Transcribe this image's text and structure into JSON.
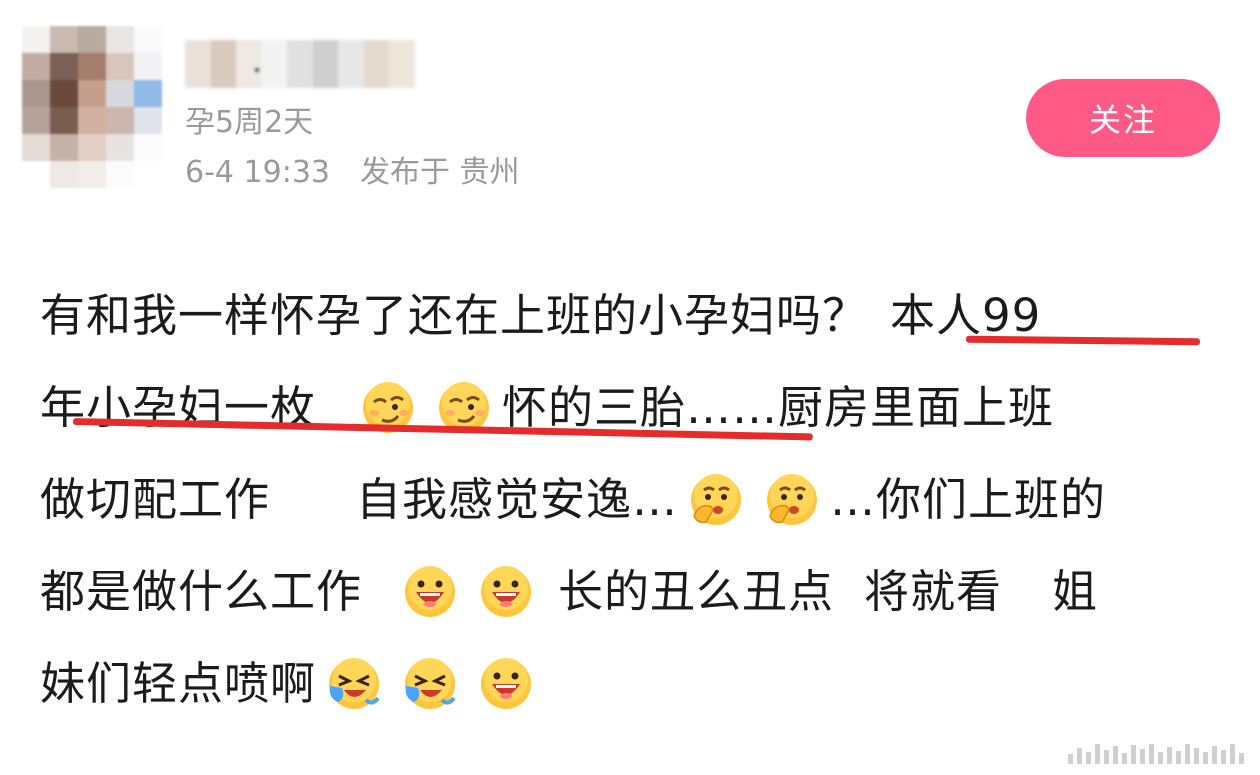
{
  "post": {
    "user_status": "孕5周2天",
    "time": "6-4 19:33",
    "location": "发布于 贵州",
    "follow_label": "关注",
    "lines": [
      {
        "segments": [
          "有和我一样怀孕了还在上班的小孕妇吗？",
          " 本人99"
        ]
      },
      {
        "segments": [
          "年小孕妇一枚",
          "怀的三胎……厨房里面上班"
        ]
      },
      {
        "segments": [
          "做切配工作",
          "自我感觉安逸…",
          "…你们上班的"
        ]
      },
      {
        "segments": [
          "都是做什么工作",
          "长的丑么丑点",
          "将就看",
          "姐"
        ]
      },
      {
        "segments": [
          "妹们轻点喷啊"
        ]
      }
    ]
  },
  "icons": {
    "emoji_smirk": "smirk-emoji-icon",
    "emoji_hand_over_mouth": "hand-over-mouth-emoji-icon",
    "emoji_laugh": "laughing-emoji-icon",
    "emoji_cry_laugh": "crying-laughing-emoji-icon"
  },
  "colors": {
    "follow_button": "#ff5a86",
    "meta_text": "#9a9a9a",
    "underline": "#e52b2b",
    "body_text": "#1b1b1b"
  }
}
